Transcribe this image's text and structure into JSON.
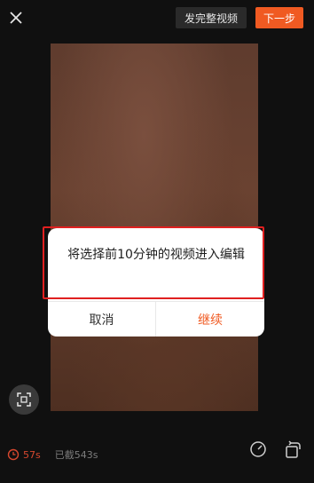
{
  "header": {
    "close_icon": "close-icon",
    "publish_full_label": "发完整视频",
    "next_label": "下一步",
    "accent_color": "#f05a22"
  },
  "preview": {
    "fit_icon": "crop-frame-icon"
  },
  "footer": {
    "duration_icon": "clock-icon",
    "duration_value": "57s",
    "selected_label": "已截543s",
    "speed_icon": "speed-gauge-icon",
    "rotate_icon": "rotate-icon"
  },
  "dialog": {
    "message": "将选择前10分钟的视频进入编辑",
    "cancel_label": "取消",
    "continue_label": "继续"
  }
}
